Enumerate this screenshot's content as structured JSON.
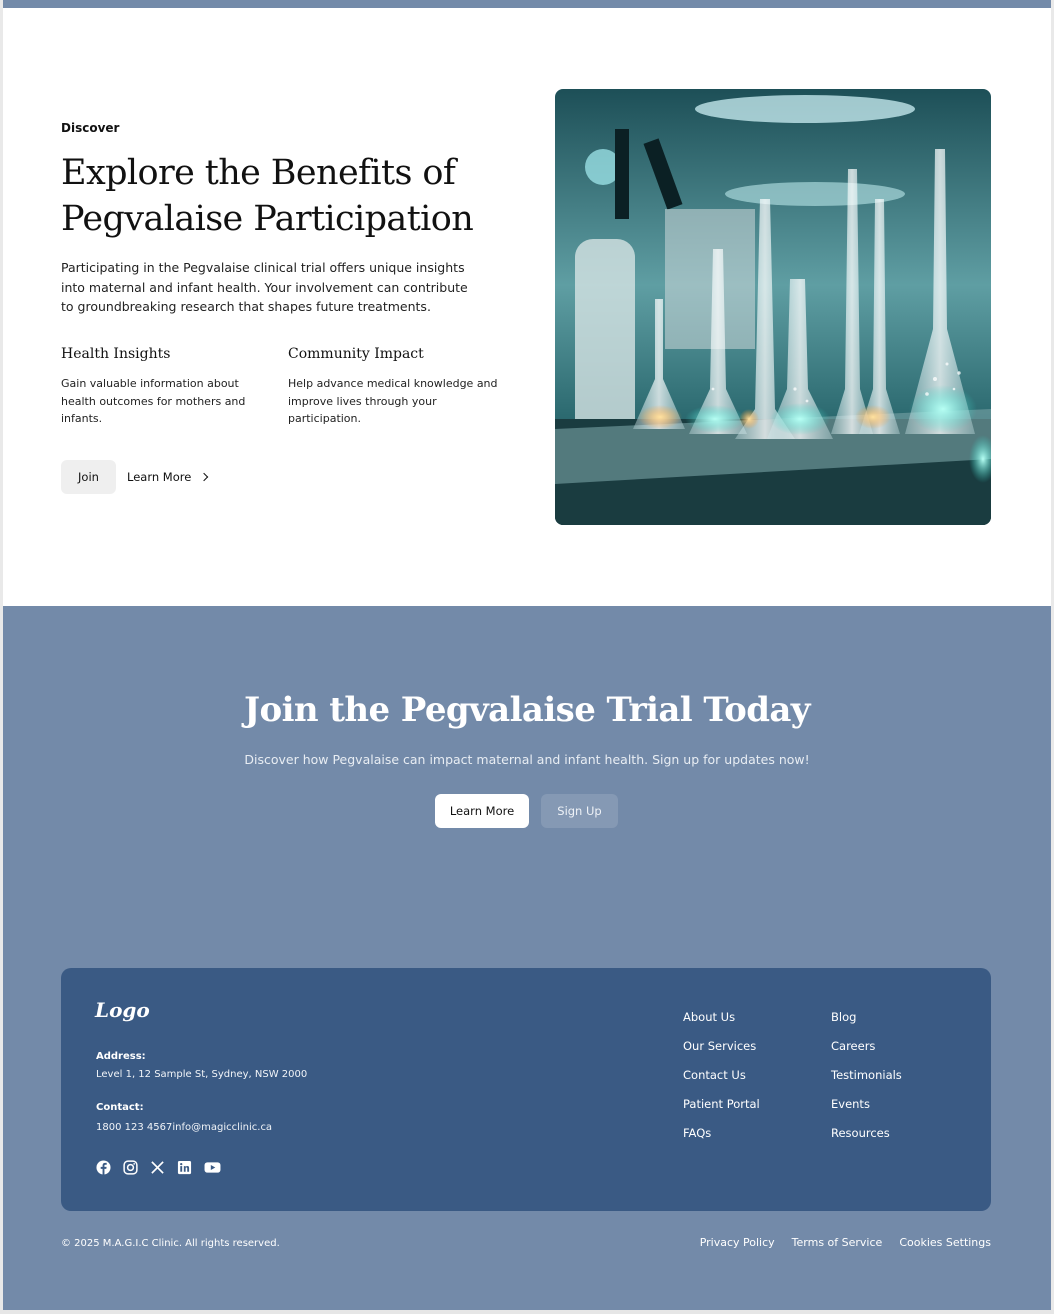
{
  "hero": {
    "eyebrow": "Discover",
    "title": "Explore the Benefits of Pegvalaise Participation",
    "description": "Participating in the Pegvalaise clinical trial offers unique insights into maternal and infant health. Your involvement can contribute to groundbreaking research that shapes future treatments.",
    "features": [
      {
        "title": "Health Insights",
        "text": "Gain valuable information about health outcomes for mothers and infants."
      },
      {
        "title": "Community Impact",
        "text": "Help advance medical knowledge and improve lives through your participation."
      }
    ],
    "join_label": "Join",
    "learn_more_label": "Learn More",
    "image_icon": "lab-glassware-photo"
  },
  "cta": {
    "title": "Join the Pegvalaise Trial Today",
    "subtitle": "Discover how Pegvalaise can impact maternal and infant health. Sign up for updates now!",
    "learn_more_label": "Learn More",
    "sign_up_label": "Sign Up"
  },
  "footer": {
    "logo": "Logo",
    "address_label": "Address:",
    "address": "Level 1, 12 Sample St, Sydney, NSW 2000",
    "contact_label": "Contact:",
    "contact": "1800 123 4567info@magicclinic.ca",
    "social_icons": [
      "facebook-icon",
      "instagram-icon",
      "x-icon",
      "linkedin-icon",
      "youtube-icon"
    ],
    "links_col1": [
      "About Us",
      "Our Services",
      "Contact Us",
      "Patient Portal",
      "FAQs"
    ],
    "links_col2": [
      "Blog",
      "Careers",
      "Testimonials",
      "Events",
      "Resources"
    ],
    "copyright": "© 2025 M.A.G.I.C Clinic. All rights reserved.",
    "legal": [
      "Privacy Policy",
      "Terms of Service",
      "Cookies Settings"
    ]
  },
  "colors": {
    "accent_blue": "#738aa9",
    "footer_card": "#3a5a84",
    "button_light": "#efefef"
  }
}
